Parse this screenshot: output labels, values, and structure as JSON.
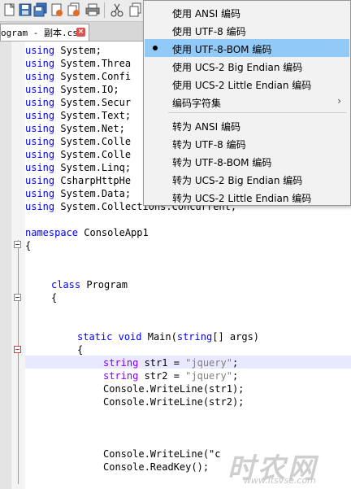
{
  "tab": {
    "label": "ogram - 副本.cs"
  },
  "toolbar": {
    "icons": [
      "new-file-icon",
      "save-icon",
      "save-all-icon",
      "close-icon",
      "close-all-icon",
      "print-icon",
      "cut-icon",
      "copy-icon"
    ]
  },
  "editor": {
    "lines": {
      "l1": {
        "kw": "using",
        "rest": " System;"
      },
      "l2": {
        "kw": "using",
        "rest": " System.Threa"
      },
      "l3": {
        "kw": "using",
        "rest": " System.Confi"
      },
      "l4": {
        "kw": "using",
        "rest": " System.IO;"
      },
      "l5": {
        "kw": "using",
        "rest": " System.Secur"
      },
      "l6": {
        "kw": "using",
        "rest": " System.Text;"
      },
      "l7": {
        "kw": "using",
        "rest": " System.Net;"
      },
      "l8": {
        "kw": "using",
        "rest": " System.Colle"
      },
      "l9": {
        "kw": "using",
        "rest": " System.Colle"
      },
      "l10": {
        "kw": "using",
        "rest": " System.Linq;"
      },
      "l11": {
        "kw": "using",
        "rest": " CsharpHttpHe"
      },
      "l12": {
        "kw": "using",
        "rest": " System.Data;"
      },
      "l13": {
        "kw": "using",
        "rest": " System.Collections.Concurrent;"
      },
      "l14": {
        "kw": "namespace",
        "rest": " ConsoleApp1"
      },
      "l15": {
        "text": "{"
      },
      "l16": {
        "kw": "class",
        "rest": " Program"
      },
      "l17": {
        "text": "{"
      },
      "l18": {
        "kw": "static",
        "kw2": "void",
        "name": " Main(",
        "tp": "string",
        "rest": "[] args)"
      },
      "l19": {
        "text": "{"
      },
      "l20": {
        "tp": "string",
        "name": " str1 = ",
        "str": "\"jquery\"",
        "end": ";"
      },
      "l21": {
        "tp": "string",
        "name": " str2 = ",
        "str": "\"jquery\"",
        "end": ";"
      },
      "l22": {
        "text": "Console.WriteLine(str1);"
      },
      "l23": {
        "text": "Console.WriteLine(str2);"
      },
      "l24": {
        "text": "Console.WriteLine(\"c"
      },
      "l25": {
        "text": "Console.ReadKey();"
      }
    }
  },
  "menu": {
    "items": [
      {
        "label": "使用 ANSI 编码"
      },
      {
        "label": "使用 UTF-8 编码"
      },
      {
        "label": "使用 UTF-8-BOM 编码",
        "selected": true
      },
      {
        "label": "使用 UCS-2 Big Endian 编码"
      },
      {
        "label": "使用 UCS-2 Little Endian 编码"
      },
      {
        "label": "编码字符集",
        "submenu": true
      },
      {
        "label": "转为 ANSI 编码"
      },
      {
        "label": "转为 UTF-8 编码"
      },
      {
        "label": "转为 UTF-8-BOM 编码"
      },
      {
        "label": "转为 UCS-2 Big Endian 编码"
      },
      {
        "label": "转为 UCS-2 Little Endian 编码"
      }
    ],
    "submenu_arrow": "›"
  },
  "watermark": {
    "main": "时农网",
    "url": "www.itsvse.com"
  },
  "colors": {
    "keyword": "#0000ff",
    "type": "#8000ff",
    "string": "#808080",
    "menu_selected": "#91c9f7",
    "highlight_line": "#e8e8ff"
  }
}
